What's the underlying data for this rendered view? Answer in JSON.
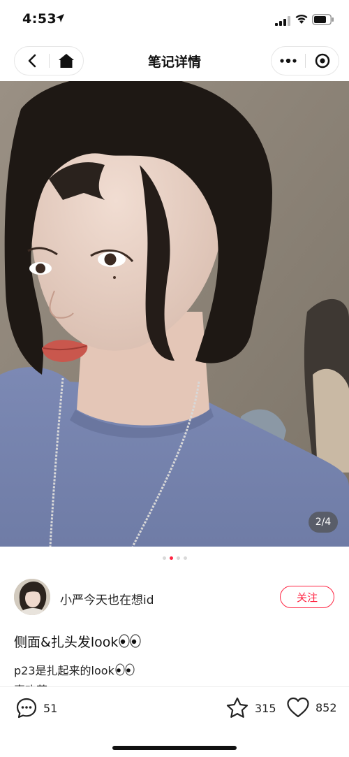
{
  "status_bar": {
    "time": "4:53",
    "icons": [
      "location-arrow-icon",
      "signal-icon",
      "wifi-icon",
      "battery-icon"
    ]
  },
  "nav": {
    "title": "笔记详情",
    "icons": [
      "back-icon",
      "home-icon",
      "more-icon",
      "close-target-icon"
    ]
  },
  "media": {
    "counter": "2/4",
    "current_page": 2,
    "total_pages": 4
  },
  "author": {
    "name": "小严今天也在想id",
    "follow_label": "关注"
  },
  "note": {
    "title": "侧面&扎头发look",
    "body": "p23是扎起来的look",
    "body_more": "喜欢蒜"
  },
  "actions": {
    "comments": "51",
    "stars": "315",
    "likes": "852"
  },
  "colors": {
    "accent": "#ff2442",
    "text": "#111111"
  }
}
